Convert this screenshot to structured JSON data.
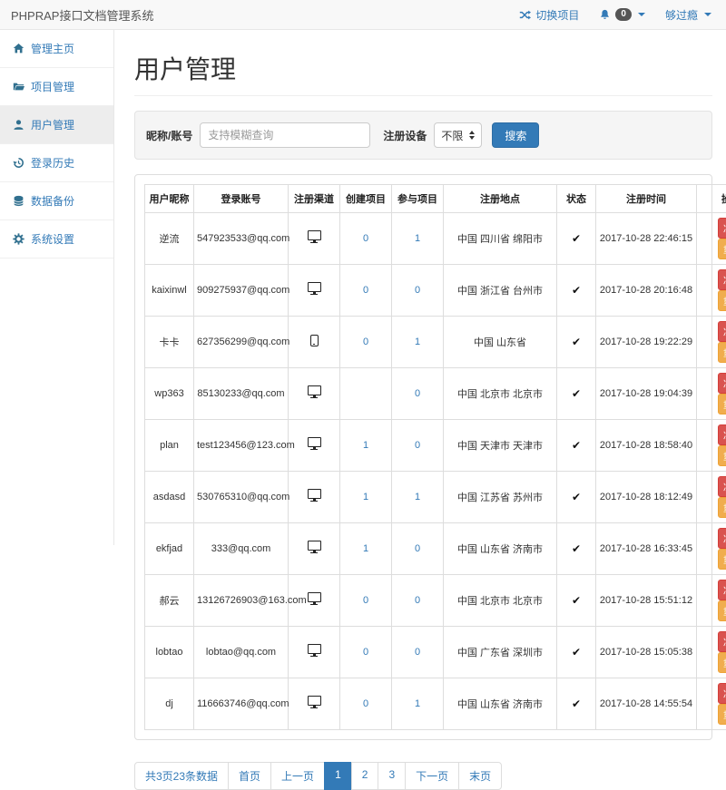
{
  "navbar": {
    "brand": "PHPRAP接口文档管理系统",
    "switch_project": "切换项目",
    "notification_count": "0",
    "username": "够过瘾"
  },
  "sidebar": {
    "items": [
      {
        "name": "home",
        "label": "管理主页",
        "icon": "home-icon",
        "active": false
      },
      {
        "name": "projects",
        "label": "项目管理",
        "icon": "folder-icon",
        "active": false
      },
      {
        "name": "users",
        "label": "用户管理",
        "icon": "user-icon",
        "active": true
      },
      {
        "name": "login-history",
        "label": "登录历史",
        "icon": "history-icon",
        "active": false
      },
      {
        "name": "data-backup",
        "label": "数据备份",
        "icon": "database-icon",
        "active": false
      },
      {
        "name": "settings",
        "label": "系统设置",
        "icon": "gear-icon",
        "active": false
      }
    ]
  },
  "page": {
    "title": "用户管理"
  },
  "search": {
    "nickname_label": "昵称/账号",
    "placeholder": "支持模糊查询",
    "device_label": "注册设备",
    "device_value": "不限",
    "button": "搜索"
  },
  "table": {
    "headers": [
      "用户昵称",
      "登录账号",
      "注册渠道",
      "创建项目",
      "参与项目",
      "注册地点",
      "状态",
      "注册时间",
      "操作面板"
    ],
    "freeze_label": "冻结用户",
    "reset_label": "重置密码",
    "rows": [
      {
        "nickname": "逆流",
        "account": "547923533@qq.com",
        "channel": "desktop",
        "created": "0",
        "joined": "1",
        "location": "中国 四川省 绵阳市",
        "status": "✔",
        "time": "2017-10-28 22:46:15"
      },
      {
        "nickname": "kaixinwl",
        "account": "909275937@qq.com",
        "channel": "desktop",
        "created": "0",
        "joined": "0",
        "location": "中国 浙江省 台州市",
        "status": "✔",
        "time": "2017-10-28 20:16:48"
      },
      {
        "nickname": "卡卡",
        "account": "627356299@qq.com",
        "channel": "mobile",
        "created": "0",
        "joined": "1",
        "location": "中国 山东省",
        "status": "✔",
        "time": "2017-10-28 19:22:29"
      },
      {
        "nickname": "wp363",
        "account": "85130233@qq.com",
        "channel": "desktop",
        "created": "",
        "joined": "0",
        "location": "中国 北京市 北京市",
        "status": "✔",
        "time": "2017-10-28 19:04:39"
      },
      {
        "nickname": "plan",
        "account": "test123456@123.com",
        "channel": "desktop",
        "created": "1",
        "joined": "0",
        "location": "中国 天津市 天津市",
        "status": "✔",
        "time": "2017-10-28 18:58:40"
      },
      {
        "nickname": "asdasd",
        "account": "530765310@qq.com",
        "channel": "desktop",
        "created": "1",
        "joined": "1",
        "location": "中国 江苏省 苏州市",
        "status": "✔",
        "time": "2017-10-28 18:12:49"
      },
      {
        "nickname": "ekfjad",
        "account": "333@qq.com",
        "channel": "desktop",
        "created": "1",
        "joined": "0",
        "location": "中国 山东省 济南市",
        "status": "✔",
        "time": "2017-10-28 16:33:45"
      },
      {
        "nickname": "郝云",
        "account": "13126726903@163.com",
        "channel": "desktop",
        "created": "0",
        "joined": "0",
        "location": "中国 北京市 北京市",
        "status": "✔",
        "time": "2017-10-28 15:51:12"
      },
      {
        "nickname": "lobtao",
        "account": "lobtao@qq.com",
        "channel": "desktop",
        "created": "0",
        "joined": "0",
        "location": "中国 广东省 深圳市",
        "status": "✔",
        "time": "2017-10-28 15:05:38"
      },
      {
        "nickname": "dj",
        "account": "116663746@qq.com",
        "channel": "desktop",
        "created": "0",
        "joined": "1",
        "location": "中国 山东省 济南市",
        "status": "✔",
        "time": "2017-10-28 14:55:54"
      }
    ]
  },
  "pagination": {
    "summary": "共3页23条数据",
    "items": [
      {
        "name": "first",
        "label": "首页",
        "active": false
      },
      {
        "name": "prev",
        "label": "上一页",
        "active": false
      },
      {
        "name": "1",
        "label": "1",
        "active": true
      },
      {
        "name": "2",
        "label": "2",
        "active": false
      },
      {
        "name": "3",
        "label": "3",
        "active": false
      },
      {
        "name": "next",
        "label": "下一页",
        "active": false
      },
      {
        "name": "last",
        "label": "末页",
        "active": false
      }
    ]
  },
  "colors": {
    "accent": "#337ab7",
    "danger": "#d9534f",
    "warning": "#f0ad4e"
  }
}
